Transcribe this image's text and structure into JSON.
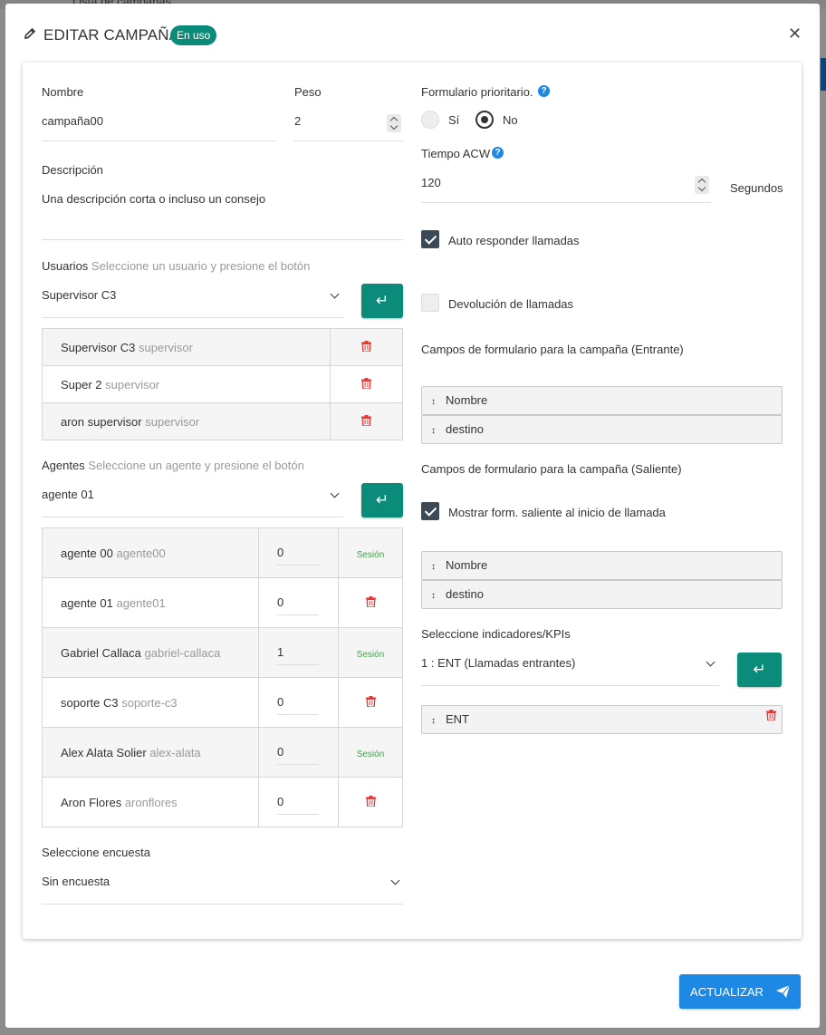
{
  "background": {
    "page_title": "Lista de campañas"
  },
  "modal": {
    "title": "EDITAR CAMPAÑA",
    "badge": "En uso",
    "close_icon": "close-icon"
  },
  "left": {
    "nombre": {
      "label": "Nombre",
      "value": "campaña00"
    },
    "peso": {
      "label": "Peso",
      "value": "2"
    },
    "descripcion": {
      "label": "Descripción",
      "placeholder": "Una descripción corta o incluso un consejo",
      "value": ""
    },
    "usuarios": {
      "label": "Usuarios",
      "hint": "Seleccione un usuario y presione el botón",
      "selected": "Supervisor C3",
      "rows": [
        {
          "name": "Supervisor C3",
          "role": "supervisor"
        },
        {
          "name": "Super 2",
          "role": "supervisor"
        },
        {
          "name": "aron supervisor",
          "role": "supervisor"
        }
      ]
    },
    "agentes": {
      "label": "Agentes",
      "hint": "Seleccione un agente y presione el botón",
      "selected": "agente 01",
      "rows": [
        {
          "name": "agente 00",
          "user": "agente00",
          "value": "0",
          "status": "Sesión"
        },
        {
          "name": "agente 01",
          "user": "agente01",
          "value": "0",
          "status": ""
        },
        {
          "name": "Gabriel Callaca",
          "user": "gabriel-callaca",
          "value": "1",
          "status": "Sesión"
        },
        {
          "name": "soporte C3",
          "user": "soporte-c3",
          "value": "0",
          "status": ""
        },
        {
          "name": "Alex Alata Solier",
          "user": "alex-alata",
          "value": "0",
          "status": "Sesión"
        },
        {
          "name": "Aron Flores",
          "user": "aronflores",
          "value": "0",
          "status": ""
        }
      ]
    },
    "encuesta": {
      "label": "Seleccione encuesta",
      "selected": "Sin encuesta"
    }
  },
  "right": {
    "formulario_prioritario": {
      "label": "Formulario prioritario.",
      "options": [
        "Sí",
        "No"
      ],
      "selected": "No"
    },
    "tiempo_acw": {
      "label": "Tiempo ACW",
      "value": "120",
      "unit": "Segundos"
    },
    "auto_responder": {
      "label": "Auto responder llamadas",
      "checked": true
    },
    "devolucion": {
      "label": "Devolución de llamadas",
      "checked": false
    },
    "campos_entrante": {
      "label": "Campos de formulario para la campaña (Entrante)",
      "fields": [
        "Nombre",
        "destino"
      ]
    },
    "campos_saliente": {
      "label": "Campos de formulario para la campaña (Saliente)"
    },
    "mostrar_saliente": {
      "label": "Mostrar form. saliente al inicio de llamada",
      "checked": true
    },
    "campos_saliente_fields": [
      "Nombre",
      "destino"
    ],
    "kpis": {
      "label": "Seleccione indicadores/KPIs",
      "selected": "1 : ENT (Llamadas entrantes)",
      "items": [
        "ENT"
      ]
    }
  },
  "footer": {
    "submit_label": "ACTUALIZAR"
  },
  "colors": {
    "teal": "#0b8c7a",
    "blue": "#1e88e5",
    "trash_red": "#e53935",
    "session_green": "#3aa845"
  }
}
